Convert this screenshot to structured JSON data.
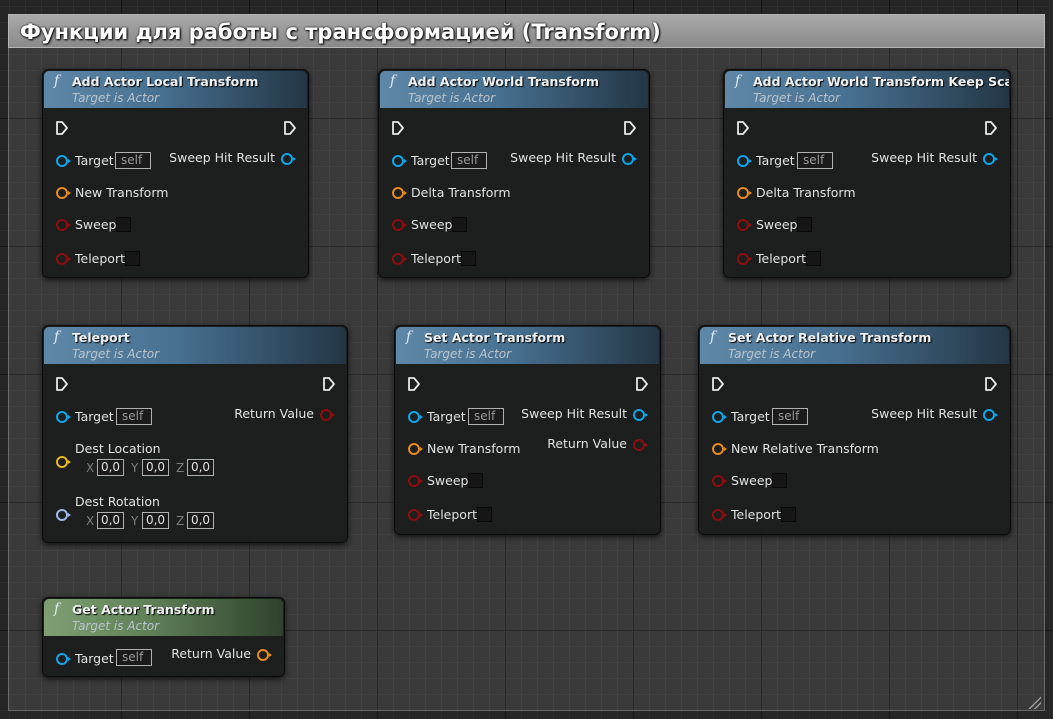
{
  "comment": {
    "title": "Функции для работы с трансформацией (Transform)"
  },
  "icons": {
    "function": "function-icon",
    "exec": "exec-pin-icon"
  },
  "pin_colors": {
    "object": "#12a4e8",
    "transform": "#e58b20",
    "bool": "#8e0e0e",
    "vector": "#e5b820",
    "rotator": "#9cb8e8"
  },
  "nodes": {
    "add_local": {
      "title": "Add Actor Local Transform",
      "subtitle": "Target is Actor",
      "target": "Target",
      "target_value": "self",
      "sweep_hit": "Sweep Hit Result",
      "transform": "New Transform",
      "sweep": "Sweep",
      "teleport": "Teleport"
    },
    "add_world": {
      "title": "Add Actor World Transform",
      "subtitle": "Target is Actor",
      "target": "Target",
      "target_value": "self",
      "sweep_hit": "Sweep Hit Result",
      "transform": "Delta Transform",
      "sweep": "Sweep",
      "teleport": "Teleport"
    },
    "add_world_keep": {
      "title": "Add Actor World Transform Keep Scale",
      "subtitle": "Target is Actor",
      "target": "Target",
      "target_value": "self",
      "sweep_hit": "Sweep Hit Result",
      "transform": "Delta Transform",
      "sweep": "Sweep",
      "teleport": "Teleport"
    },
    "teleport": {
      "title": "Teleport",
      "subtitle": "Target is Actor",
      "target": "Target",
      "target_value": "self",
      "return": "Return Value",
      "dest_location": "Dest Location",
      "dest_rotation": "Dest Rotation",
      "x_label": "X",
      "y_label": "Y",
      "z_label": "Z",
      "loc": {
        "x": "0,0",
        "y": "0,0",
        "z": "0,0"
      },
      "rot": {
        "x": "0,0",
        "y": "0,0",
        "z": "0,0"
      }
    },
    "set_transform": {
      "title": "Set Actor Transform",
      "subtitle": "Target is Actor",
      "target": "Target",
      "target_value": "self",
      "sweep_hit": "Sweep Hit Result",
      "return": "Return Value",
      "transform": "New Transform",
      "sweep": "Sweep",
      "teleport": "Teleport"
    },
    "set_relative": {
      "title": "Set Actor Relative Transform",
      "subtitle": "Target is Actor",
      "target": "Target",
      "target_value": "self",
      "sweep_hit": "Sweep Hit Result",
      "transform": "New Relative Transform",
      "sweep": "Sweep",
      "teleport": "Teleport"
    },
    "get_transform": {
      "title": "Get Actor Transform",
      "subtitle": "Target is Actor",
      "target": "Target",
      "target_value": "self",
      "return": "Return Value"
    }
  }
}
